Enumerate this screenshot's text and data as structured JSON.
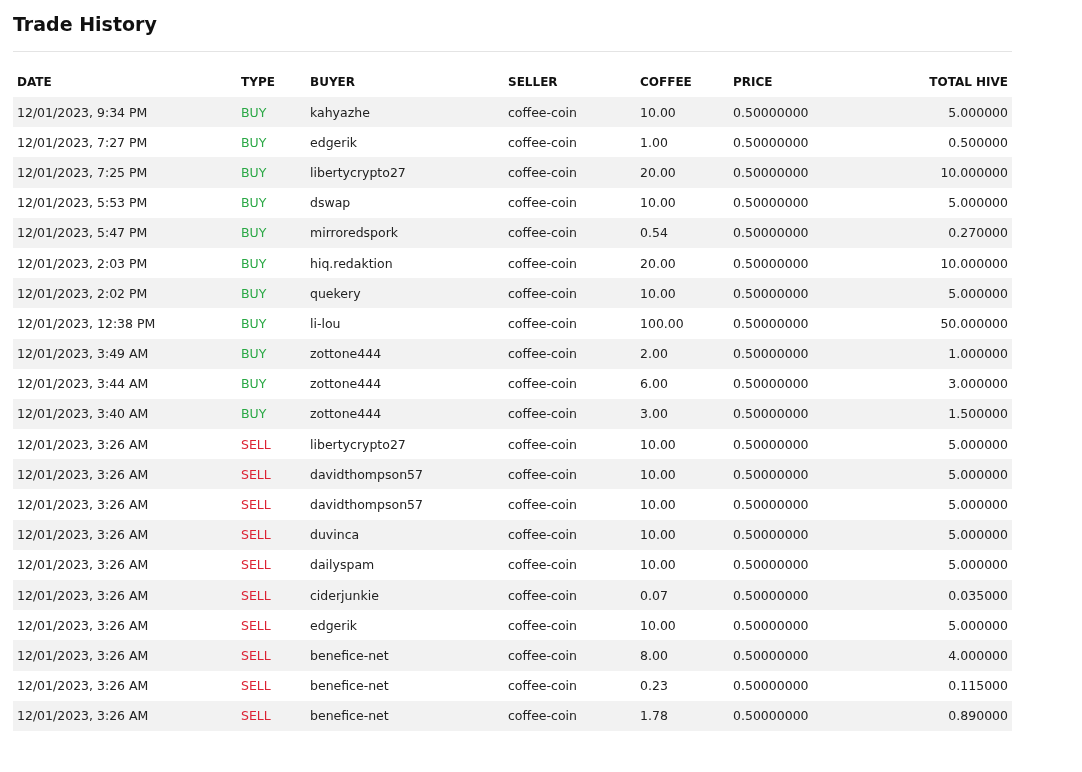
{
  "title": "Trade History",
  "table": {
    "columns": [
      "DATE",
      "TYPE",
      "BUYER",
      "SELLER",
      "COFFEE",
      "PRICE",
      "TOTAL HIVE"
    ],
    "rows": [
      {
        "date": "12/01/2023, 9:34 PM",
        "type": {
          "kind": "buy",
          "label": "BUY"
        },
        "buyer": "kahyazhe",
        "seller": "coffee-coin",
        "coffee": "10.00",
        "price": "0.50000000",
        "total_hive": "5.000000"
      },
      {
        "date": "12/01/2023, 7:27 PM",
        "type": {
          "kind": "buy",
          "label": "BUY"
        },
        "buyer": "edgerik",
        "seller": "coffee-coin",
        "coffee": "1.00",
        "price": "0.50000000",
        "total_hive": "0.500000"
      },
      {
        "date": "12/01/2023, 7:25 PM",
        "type": {
          "kind": "buy",
          "label": "BUY"
        },
        "buyer": "libertycrypto27",
        "seller": "coffee-coin",
        "coffee": "20.00",
        "price": "0.50000000",
        "total_hive": "10.000000"
      },
      {
        "date": "12/01/2023, 5:53 PM",
        "type": {
          "kind": "buy",
          "label": "BUY"
        },
        "buyer": "dswap",
        "seller": "coffee-coin",
        "coffee": "10.00",
        "price": "0.50000000",
        "total_hive": "5.000000"
      },
      {
        "date": "12/01/2023, 5:47 PM",
        "type": {
          "kind": "buy",
          "label": "BUY"
        },
        "buyer": "mirroredspork",
        "seller": "coffee-coin",
        "coffee": "0.54",
        "price": "0.50000000",
        "total_hive": "0.270000"
      },
      {
        "date": "12/01/2023, 2:03 PM",
        "type": {
          "kind": "buy",
          "label": "BUY"
        },
        "buyer": "hiq.redaktion",
        "seller": "coffee-coin",
        "coffee": "20.00",
        "price": "0.50000000",
        "total_hive": "10.000000"
      },
      {
        "date": "12/01/2023, 2:02 PM",
        "type": {
          "kind": "buy",
          "label": "BUY"
        },
        "buyer": "quekery",
        "seller": "coffee-coin",
        "coffee": "10.00",
        "price": "0.50000000",
        "total_hive": "5.000000"
      },
      {
        "date": "12/01/2023, 12:38 PM",
        "type": {
          "kind": "buy",
          "label": "BUY"
        },
        "buyer": "li-lou",
        "seller": "coffee-coin",
        "coffee": "100.00",
        "price": "0.50000000",
        "total_hive": "50.000000"
      },
      {
        "date": "12/01/2023, 3:49 AM",
        "type": {
          "kind": "buy",
          "label": "BUY"
        },
        "buyer": "zottone444",
        "seller": "coffee-coin",
        "coffee": "2.00",
        "price": "0.50000000",
        "total_hive": "1.000000"
      },
      {
        "date": "12/01/2023, 3:44 AM",
        "type": {
          "kind": "buy",
          "label": "BUY"
        },
        "buyer": "zottone444",
        "seller": "coffee-coin",
        "coffee": "6.00",
        "price": "0.50000000",
        "total_hive": "3.000000"
      },
      {
        "date": "12/01/2023, 3:40 AM",
        "type": {
          "kind": "buy",
          "label": "BUY"
        },
        "buyer": "zottone444",
        "seller": "coffee-coin",
        "coffee": "3.00",
        "price": "0.50000000",
        "total_hive": "1.500000"
      },
      {
        "date": "12/01/2023, 3:26 AM",
        "type": {
          "kind": "sell",
          "label": "SELL"
        },
        "buyer": "libertycrypto27",
        "seller": "coffee-coin",
        "coffee": "10.00",
        "price": "0.50000000",
        "total_hive": "5.000000"
      },
      {
        "date": "12/01/2023, 3:26 AM",
        "type": {
          "kind": "sell",
          "label": "SELL"
        },
        "buyer": "davidthompson57",
        "seller": "coffee-coin",
        "coffee": "10.00",
        "price": "0.50000000",
        "total_hive": "5.000000"
      },
      {
        "date": "12/01/2023, 3:26 AM",
        "type": {
          "kind": "sell",
          "label": "SELL"
        },
        "buyer": "davidthompson57",
        "seller": "coffee-coin",
        "coffee": "10.00",
        "price": "0.50000000",
        "total_hive": "5.000000"
      },
      {
        "date": "12/01/2023, 3:26 AM",
        "type": {
          "kind": "sell",
          "label": "SELL"
        },
        "buyer": "duvinca",
        "seller": "coffee-coin",
        "coffee": "10.00",
        "price": "0.50000000",
        "total_hive": "5.000000"
      },
      {
        "date": "12/01/2023, 3:26 AM",
        "type": {
          "kind": "sell",
          "label": "SELL"
        },
        "buyer": "dailyspam",
        "seller": "coffee-coin",
        "coffee": "10.00",
        "price": "0.50000000",
        "total_hive": "5.000000"
      },
      {
        "date": "12/01/2023, 3:26 AM",
        "type": {
          "kind": "sell",
          "label": "SELL"
        },
        "buyer": "ciderjunkie",
        "seller": "coffee-coin",
        "coffee": "0.07",
        "price": "0.50000000",
        "total_hive": "0.035000"
      },
      {
        "date": "12/01/2023, 3:26 AM",
        "type": {
          "kind": "sell",
          "label": "SELL"
        },
        "buyer": "edgerik",
        "seller": "coffee-coin",
        "coffee": "10.00",
        "price": "0.50000000",
        "total_hive": "5.000000"
      },
      {
        "date": "12/01/2023, 3:26 AM",
        "type": {
          "kind": "sell",
          "label": "SELL"
        },
        "buyer": "benefice-net",
        "seller": "coffee-coin",
        "coffee": "8.00",
        "price": "0.50000000",
        "total_hive": "4.000000"
      },
      {
        "date": "12/01/2023, 3:26 AM",
        "type": {
          "kind": "sell",
          "label": "SELL"
        },
        "buyer": "benefice-net",
        "seller": "coffee-coin",
        "coffee": "0.23",
        "price": "0.50000000",
        "total_hive": "0.115000"
      },
      {
        "date": "12/01/2023, 3:26 AM",
        "type": {
          "kind": "sell",
          "label": "SELL"
        },
        "buyer": "benefice-net",
        "seller": "coffee-coin",
        "coffee": "1.78",
        "price": "0.50000000",
        "total_hive": "0.890000"
      }
    ]
  }
}
